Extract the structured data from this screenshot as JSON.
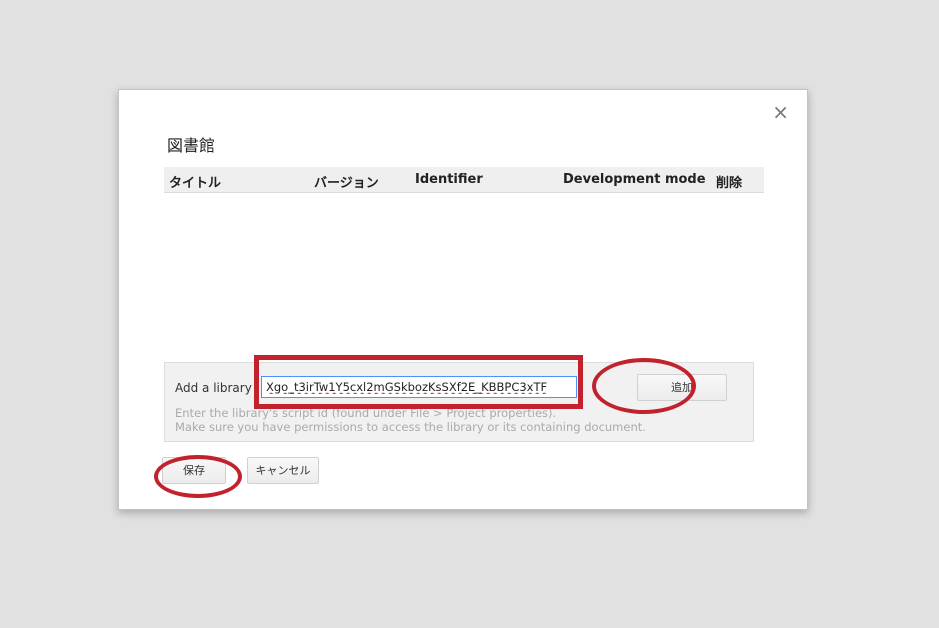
{
  "dialog": {
    "title": "図書館",
    "close_label": "×"
  },
  "table": {
    "columns": [
      "タイトル",
      "バージョン",
      "Identifier",
      "Development mode",
      "削除"
    ]
  },
  "add_library": {
    "label": "Add a library",
    "input_value": "Xgo_t3irTw1Y5cxl2mGSkbozKsSXf2E_KBBPC3xTF",
    "help_line_1": "Enter the library's script id (found under File > Project properties).",
    "help_line_2": "Make sure you have permissions to access the library or its containing document.",
    "add_button": "追加"
  },
  "footer": {
    "save_button": "保存",
    "cancel_button": "キャンセル"
  },
  "colors": {
    "annotation_red": "#c1222d",
    "input_focus_border": "#4d90fe"
  }
}
